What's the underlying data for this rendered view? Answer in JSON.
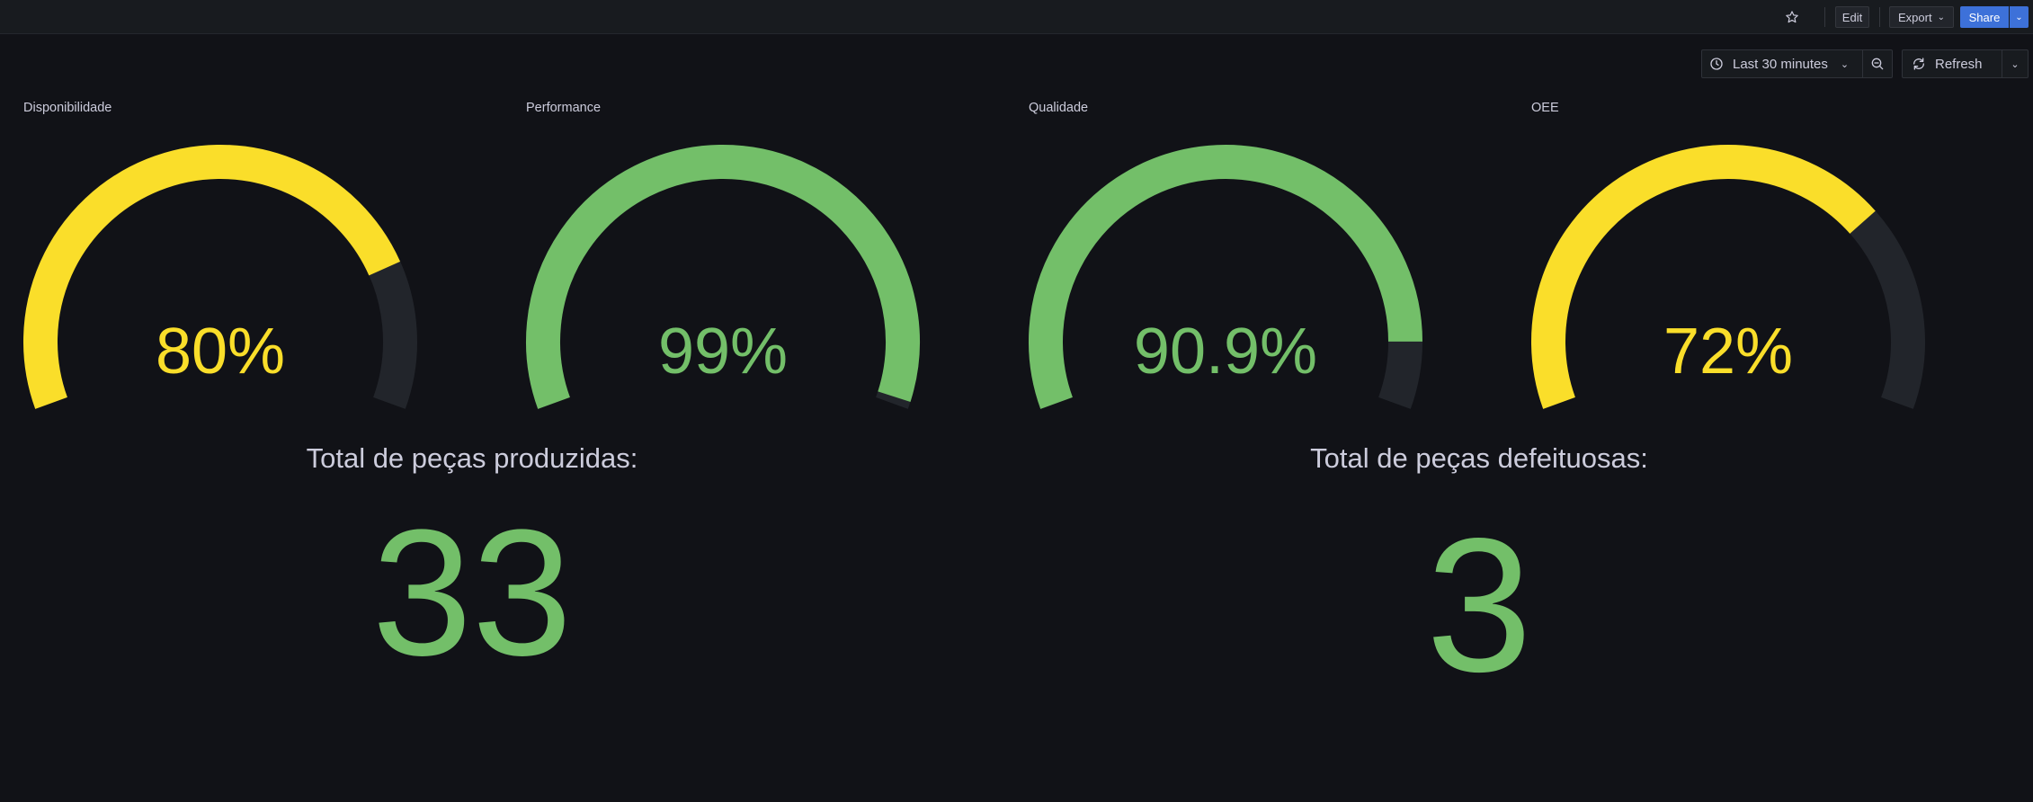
{
  "toolbar": {
    "edit_label": "Edit",
    "export_label": "Export",
    "share_label": "Share"
  },
  "controls": {
    "time_range": "Last 30 minutes",
    "refresh_label": "Refresh"
  },
  "gauges": [
    {
      "title": "Disponibilidade",
      "value_text": "80%",
      "value": 80,
      "color": "#fade2a"
    },
    {
      "title": "Performance",
      "value_text": "99%",
      "value": 99,
      "color": "#73bf69"
    },
    {
      "title": "Qualidade",
      "value_text": "90.9%",
      "value": 90.9,
      "color": "#73bf69"
    },
    {
      "title": "OEE",
      "value_text": "72%",
      "value": 72,
      "color": "#fade2a"
    }
  ],
  "stats": [
    {
      "title": "Total de peças produzidas:",
      "value": "33",
      "color": "#73bf69"
    },
    {
      "title": "Total de peças defeituosas:",
      "value": "3",
      "color": "#73bf69"
    }
  ],
  "colors": {
    "background": "#111217",
    "gauge_track": "#22252b",
    "green": "#73bf69",
    "yellow": "#fade2a",
    "primary": "#3d71d9"
  }
}
